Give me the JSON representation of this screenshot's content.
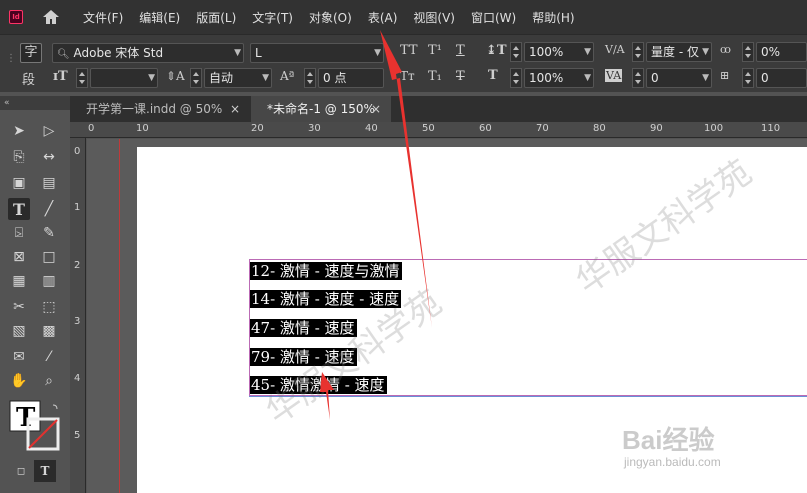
{
  "app": {
    "logo_text": "Id"
  },
  "menu": [
    "文件(F)",
    "编辑(E)",
    "版面(L)",
    "文字(T)",
    "对象(O)",
    "表(A)",
    "视图(V)",
    "窗口(W)",
    "帮助(H)"
  ],
  "control": {
    "char_label": "字",
    "para_label": "段",
    "font_family": "Adobe 宋体 Std",
    "font_style": "L",
    "leading": "自动",
    "kerning": "0 点",
    "vscale": "100%",
    "hscale": "100%",
    "tracking_mode": "量度 - 仅",
    "tracking": "0",
    "baseline": "0%",
    "grid_value": "0"
  },
  "tabs": [
    {
      "label": "开学第一课.indd @ 50%",
      "close": "×"
    },
    {
      "label": "*未命名-1 @ 150%",
      "close": "×"
    }
  ],
  "ruler_h": [
    "0",
    "10",
    "20",
    "30",
    "40",
    "50",
    "60",
    "70",
    "80",
    "90",
    "100",
    "110"
  ],
  "ruler_v": [
    "0",
    "1",
    "2",
    "3",
    "4",
    "5"
  ],
  "text_lines": [
    "12- 激情 - 速度与激情",
    "14- 激情 - 速度 - 速度",
    "47- 激情 - 速度",
    "79- 激情 - 速度",
    "45- 激情激情 - 速度"
  ],
  "watermark": {
    "text": "华服文科学苑",
    "brand": "Bai经验",
    "sub": "jingyan.baidu.com"
  },
  "colors": {
    "arrow": "#e8322f",
    "selection": "#000000",
    "margin": "#d04bbf"
  }
}
